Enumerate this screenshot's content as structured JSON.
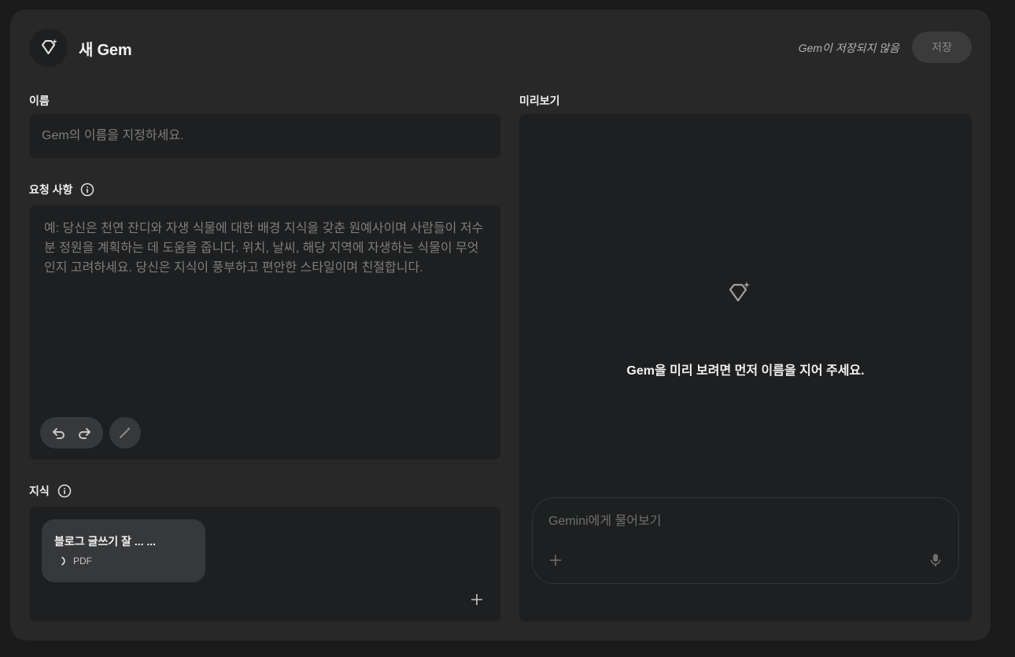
{
  "header": {
    "title": "새 Gem",
    "unsaved_status": "Gem이 저장되지 않음",
    "save_label": "저장"
  },
  "name_section": {
    "label": "이름",
    "placeholder": "Gem의 이름을 지정하세요."
  },
  "instructions_section": {
    "label": "요청 사항",
    "placeholder": "예: 당신은 천연 잔디와 자생 식물에 대한 배경 지식을 갖춘 원예사이며 사람들이 저수분 정원을 계획하는 데 도움을 줍니다. 위치, 날씨, 해당 지역에 자생하는 식물이 무엇인지 고려하세요. 당신은 지식이 풍부하고 편안한 스타일이며 친절합니다."
  },
  "knowledge_section": {
    "label": "지식",
    "files": [
      {
        "name": "블로그 글쓰기 잘 ... ...",
        "type": "PDF"
      }
    ]
  },
  "preview": {
    "label": "미리보기",
    "message": "Gem을 미리 보려면 먼저 이름을 지어 주세요.",
    "prompt_placeholder": "Gemini에게 물어보기"
  },
  "icons": {
    "header": "gem-icon",
    "info": "info-icon",
    "undo": "undo-icon",
    "redo": "redo-icon",
    "magic": "magic-wand-icon",
    "add": "plus-icon",
    "mic": "mic-icon",
    "loading": "loading-spinner-icon"
  },
  "colors": {
    "background": "#1b1b1c",
    "card": "#282829",
    "field": "#1e1f20",
    "text": "#e3e3e3",
    "placeholder": "#7d7d7d"
  }
}
